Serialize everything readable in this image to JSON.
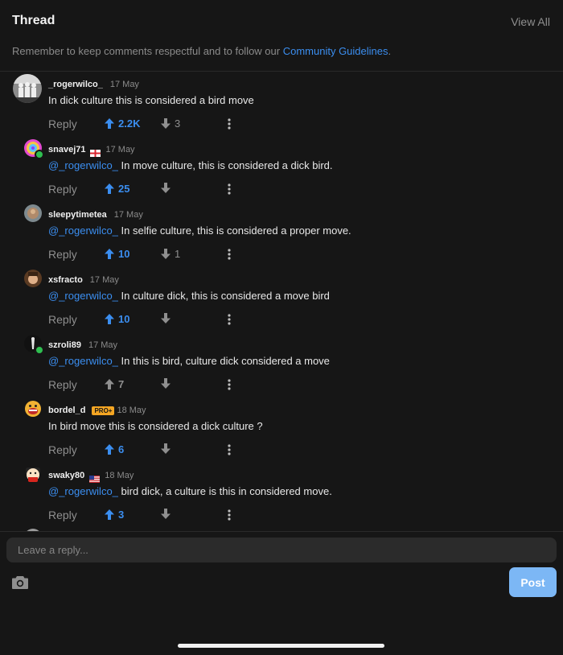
{
  "header": {
    "title": "Thread",
    "view_all": "View All",
    "notice_prefix": "Remember to keep comments respectful and to follow our ",
    "notice_link": "Community Guidelines",
    "notice_suffix": "."
  },
  "comments": [
    {
      "username": "_rogerwilco_",
      "time": "17 May",
      "mention": "",
      "text": "In dick culture this is considered a bird move",
      "reply": "Reply",
      "upvotes": "2.2K",
      "downvotes": "3"
    },
    {
      "username": "snavej71",
      "time": "17 May",
      "mention": "@_rogerwilco_",
      "text": " In move culture, this is considered a dick bird.",
      "reply": "Reply",
      "upvotes": "25",
      "downvotes": ""
    },
    {
      "username": "sleepytimetea",
      "time": "17 May",
      "mention": "@_rogerwilco_",
      "text": " In selfie culture, this is considered a proper move.",
      "reply": "Reply",
      "upvotes": "10",
      "downvotes": "1"
    },
    {
      "username": "xsfracto",
      "time": "17 May",
      "mention": "@_rogerwilco_",
      "text": " In culture dick, this is considered a move bird",
      "reply": "Reply",
      "upvotes": "10",
      "downvotes": ""
    },
    {
      "username": "szroli89",
      "time": "17 May",
      "mention": "@_rogerwilco_",
      "text": " In this is bird, culture dick considered a move",
      "reply": "Reply",
      "upvotes": "7",
      "downvotes": ""
    },
    {
      "username": "bordel_d",
      "badge": "PRO+",
      "time": "18 May",
      "mention": "",
      "text": "In bird move this is considered a dick culture ?",
      "reply": "Reply",
      "upvotes": "6",
      "downvotes": ""
    },
    {
      "username": "swaky80",
      "time": "18 May",
      "mention": "@_rogerwilco_",
      "text": " bird dick, a culture is this in considered move.",
      "reply": "Reply",
      "upvotes": "3",
      "downvotes": ""
    }
  ],
  "composer": {
    "placeholder": "Leave a reply...",
    "post_label": "Post"
  },
  "icons": {
    "upvote": "arrow-up-icon",
    "downvote": "arrow-down-icon",
    "more": "more-vertical-icon",
    "camera": "camera-icon",
    "flags": [
      "england-flag-icon",
      "us-flag-icon"
    ]
  },
  "colors": {
    "background": "#161616",
    "accent": "#3b8ef0",
    "post_button": "#7cb7f5",
    "pro_badge": "#f5a623",
    "online": "#2fbf50"
  }
}
